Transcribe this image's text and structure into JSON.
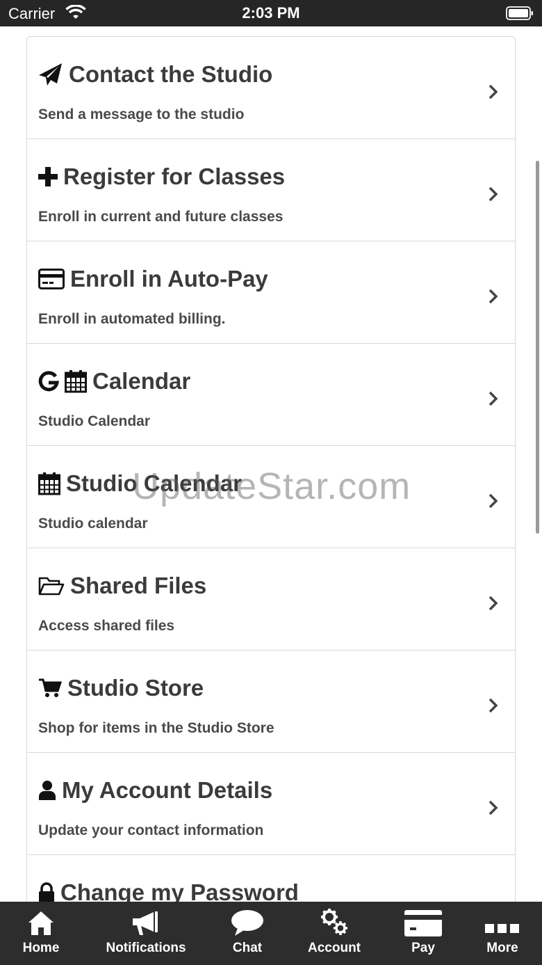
{
  "status_bar": {
    "carrier": "Carrier",
    "time": "2:03 PM"
  },
  "menu": {
    "items": [
      {
        "title": "Contact the Studio",
        "subtitle": "Send a message to the studio",
        "icon": "paper-plane-icon"
      },
      {
        "title": "Register for Classes",
        "subtitle": "Enroll in current and future classes",
        "icon": "plus-icon"
      },
      {
        "title": "Enroll in Auto-Pay",
        "subtitle": "Enroll in automated billing.",
        "icon": "credit-card-icon"
      },
      {
        "title": "Calendar",
        "subtitle": "Studio Calendar",
        "icon": "google-calendar-icon"
      },
      {
        "title": "Studio Calendar",
        "subtitle": "Studio calendar",
        "icon": "calendar-icon"
      },
      {
        "title": "Shared Files",
        "subtitle": "Access shared files",
        "icon": "folder-open-icon"
      },
      {
        "title": "Studio Store",
        "subtitle": "Shop for items in the Studio Store",
        "icon": "cart-icon"
      },
      {
        "title": "My Account Details",
        "subtitle": "Update your contact information",
        "icon": "user-icon"
      },
      {
        "title": "Change my Password",
        "subtitle": "",
        "icon": "lock-icon"
      }
    ]
  },
  "watermark": "UpdateStar.com",
  "tab_bar": {
    "tabs": [
      {
        "label": "Home",
        "icon": "home-icon"
      },
      {
        "label": "Notifications",
        "icon": "megaphone-icon"
      },
      {
        "label": "Chat",
        "icon": "chat-bubble-icon"
      },
      {
        "label": "Account",
        "icon": "gears-icon"
      },
      {
        "label": "Pay",
        "icon": "credit-card-icon"
      },
      {
        "label": "More",
        "icon": "more-icon"
      }
    ]
  }
}
